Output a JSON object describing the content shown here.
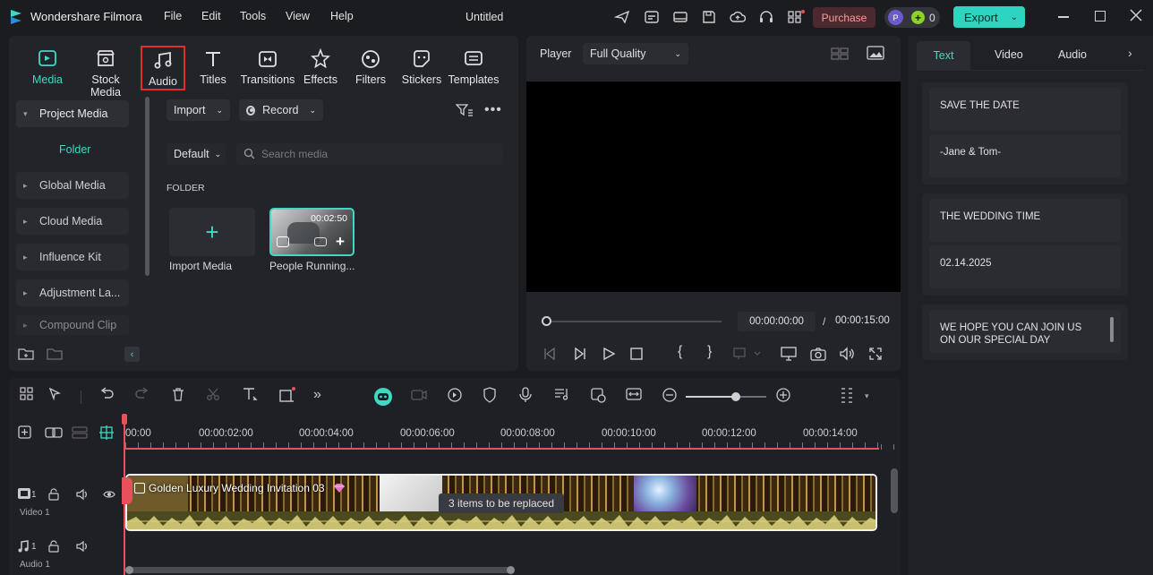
{
  "app": {
    "name": "Wondershare Filmora",
    "project_title": "Untitled"
  },
  "menu": [
    "File",
    "Edit",
    "Tools",
    "View",
    "Help"
  ],
  "titlebar": {
    "purchase_label": "Purchase",
    "avatar_letter": "P",
    "credits": "0",
    "export_label": "Export"
  },
  "media_tabs": [
    "Media",
    "Stock Media",
    "Audio",
    "Titles",
    "Transitions",
    "Effects",
    "Filters",
    "Stickers",
    "Templates"
  ],
  "sidebar": {
    "project_media": "Project Media",
    "folder": "Folder",
    "items": [
      "Global Media",
      "Cloud Media",
      "Influence Kit",
      "Adjustment La...",
      "Compound Clip"
    ]
  },
  "media_toolbar": {
    "import_label": "Import",
    "record_label": "Record",
    "sort_label": "Default",
    "search_placeholder": "Search media"
  },
  "media_area": {
    "section_label": "FOLDER",
    "import_media_label": "Import Media",
    "clip_name": "People Running...",
    "clip_duration": "00:02:50"
  },
  "player": {
    "label": "Player",
    "quality": "Full Quality",
    "current_time": "00:00:00:00",
    "separator": "/",
    "total_time": "00:00:15:00"
  },
  "right_panel": {
    "tabs": [
      "Text",
      "Video",
      "Audio"
    ],
    "active_tab": "Text",
    "groups": [
      [
        "SAVE THE DATE",
        "-Jane & Tom-"
      ],
      [
        "THE WEDDING TIME",
        "02.14.2025"
      ],
      [
        "WE HOPE YOU CAN JOIN US ON OUR SPECIAL DAY"
      ]
    ]
  },
  "timeline": {
    "ruler": [
      "00:00",
      "00:00:02:00",
      "00:00:04:00",
      "00:00:06:00",
      "00:00:08:00",
      "00:00:10:00",
      "00:00:12:00",
      "00:00:14:00"
    ],
    "clip_title": "Golden Luxury Wedding Invitation 03",
    "replace_tooltip": "3 items to be replaced",
    "video_track_num": "1",
    "video_track_label": "Video 1",
    "audio_track_num": "1",
    "audio_track_label": "Audio 1"
  },
  "colors": {
    "accent": "#3fd9c3",
    "purchase_bg": "#4a2a2e",
    "purchase_text": "#ff8c8c",
    "export_bg": "#2dd4bf",
    "highlight_box": "#e02d2d",
    "playhead": "#e8505b"
  }
}
